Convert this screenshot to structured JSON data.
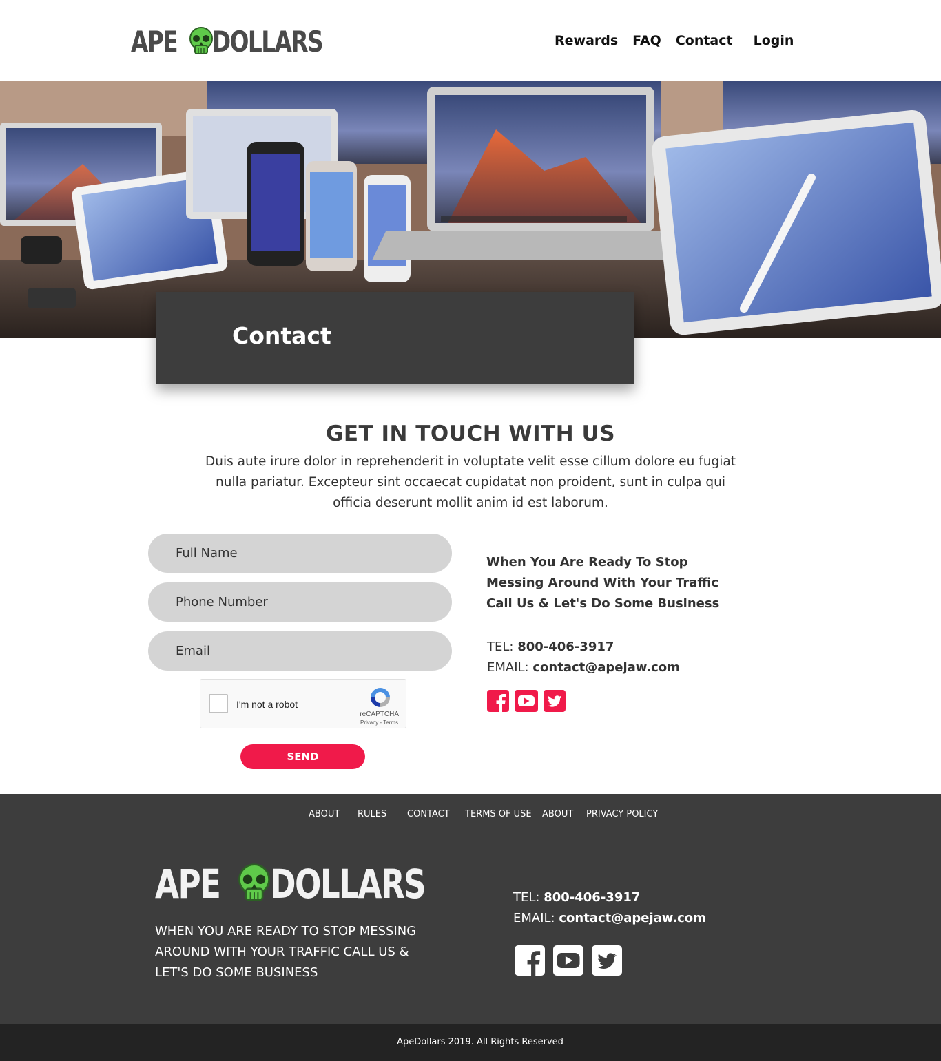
{
  "brand": {
    "logo_left": "APE",
    "logo_right": "DOLLARS"
  },
  "nav": {
    "items": [
      "Rewards",
      "FAQ",
      "Contact",
      "Login"
    ]
  },
  "hero": {
    "title": "Contact"
  },
  "intro": {
    "heading": "GET IN TOUCH WITH US",
    "text": "Duis aute irure dolor in reprehenderit in voluptate velit esse cillum dolore eu fugiat nulla pariatur. Excepteur sint occaecat cupidatat non proident, sunt in culpa qui officia deserunt mollit anim id est laborum."
  },
  "form": {
    "full_name_placeholder": "Full Name",
    "phone_placeholder": "Phone Number",
    "email_placeholder": "Email",
    "captcha_label": "I'm not a robot",
    "captcha_brand": "reCAPTCHA",
    "captcha_links": "Privacy - Terms",
    "send_label": "SEND"
  },
  "contact": {
    "tagline": "When You Are Ready To Stop Messing Around With Your Traffic Call Us & Let's Do Some Business",
    "tel_label": "TEL:",
    "tel": "800-406-3917",
    "email_label": "EMAIL:",
    "email": "contact@apejaw.com",
    "social_icons": [
      "facebook-icon",
      "youtube-icon",
      "twitter-icon"
    ],
    "accent_color": "#f01a4a"
  },
  "footer": {
    "nav": [
      "ABOUT",
      "RULES",
      "CONTACT",
      "TERMS OF USE",
      "ABOUT",
      "PRIVACY POLICY"
    ],
    "tagline": "WHEN YOU ARE READY TO STOP MESSING AROUND WITH YOUR TRAFFIC CALL US & LET'S DO SOME BUSINESS",
    "tel_label": "TEL:",
    "tel": "800-406-3917",
    "email_label": "EMAIL:",
    "email": "contact@apejaw.com",
    "background": "#3d3d3d",
    "copyright": "ApeDollars 2019. All Rights Reserved"
  }
}
